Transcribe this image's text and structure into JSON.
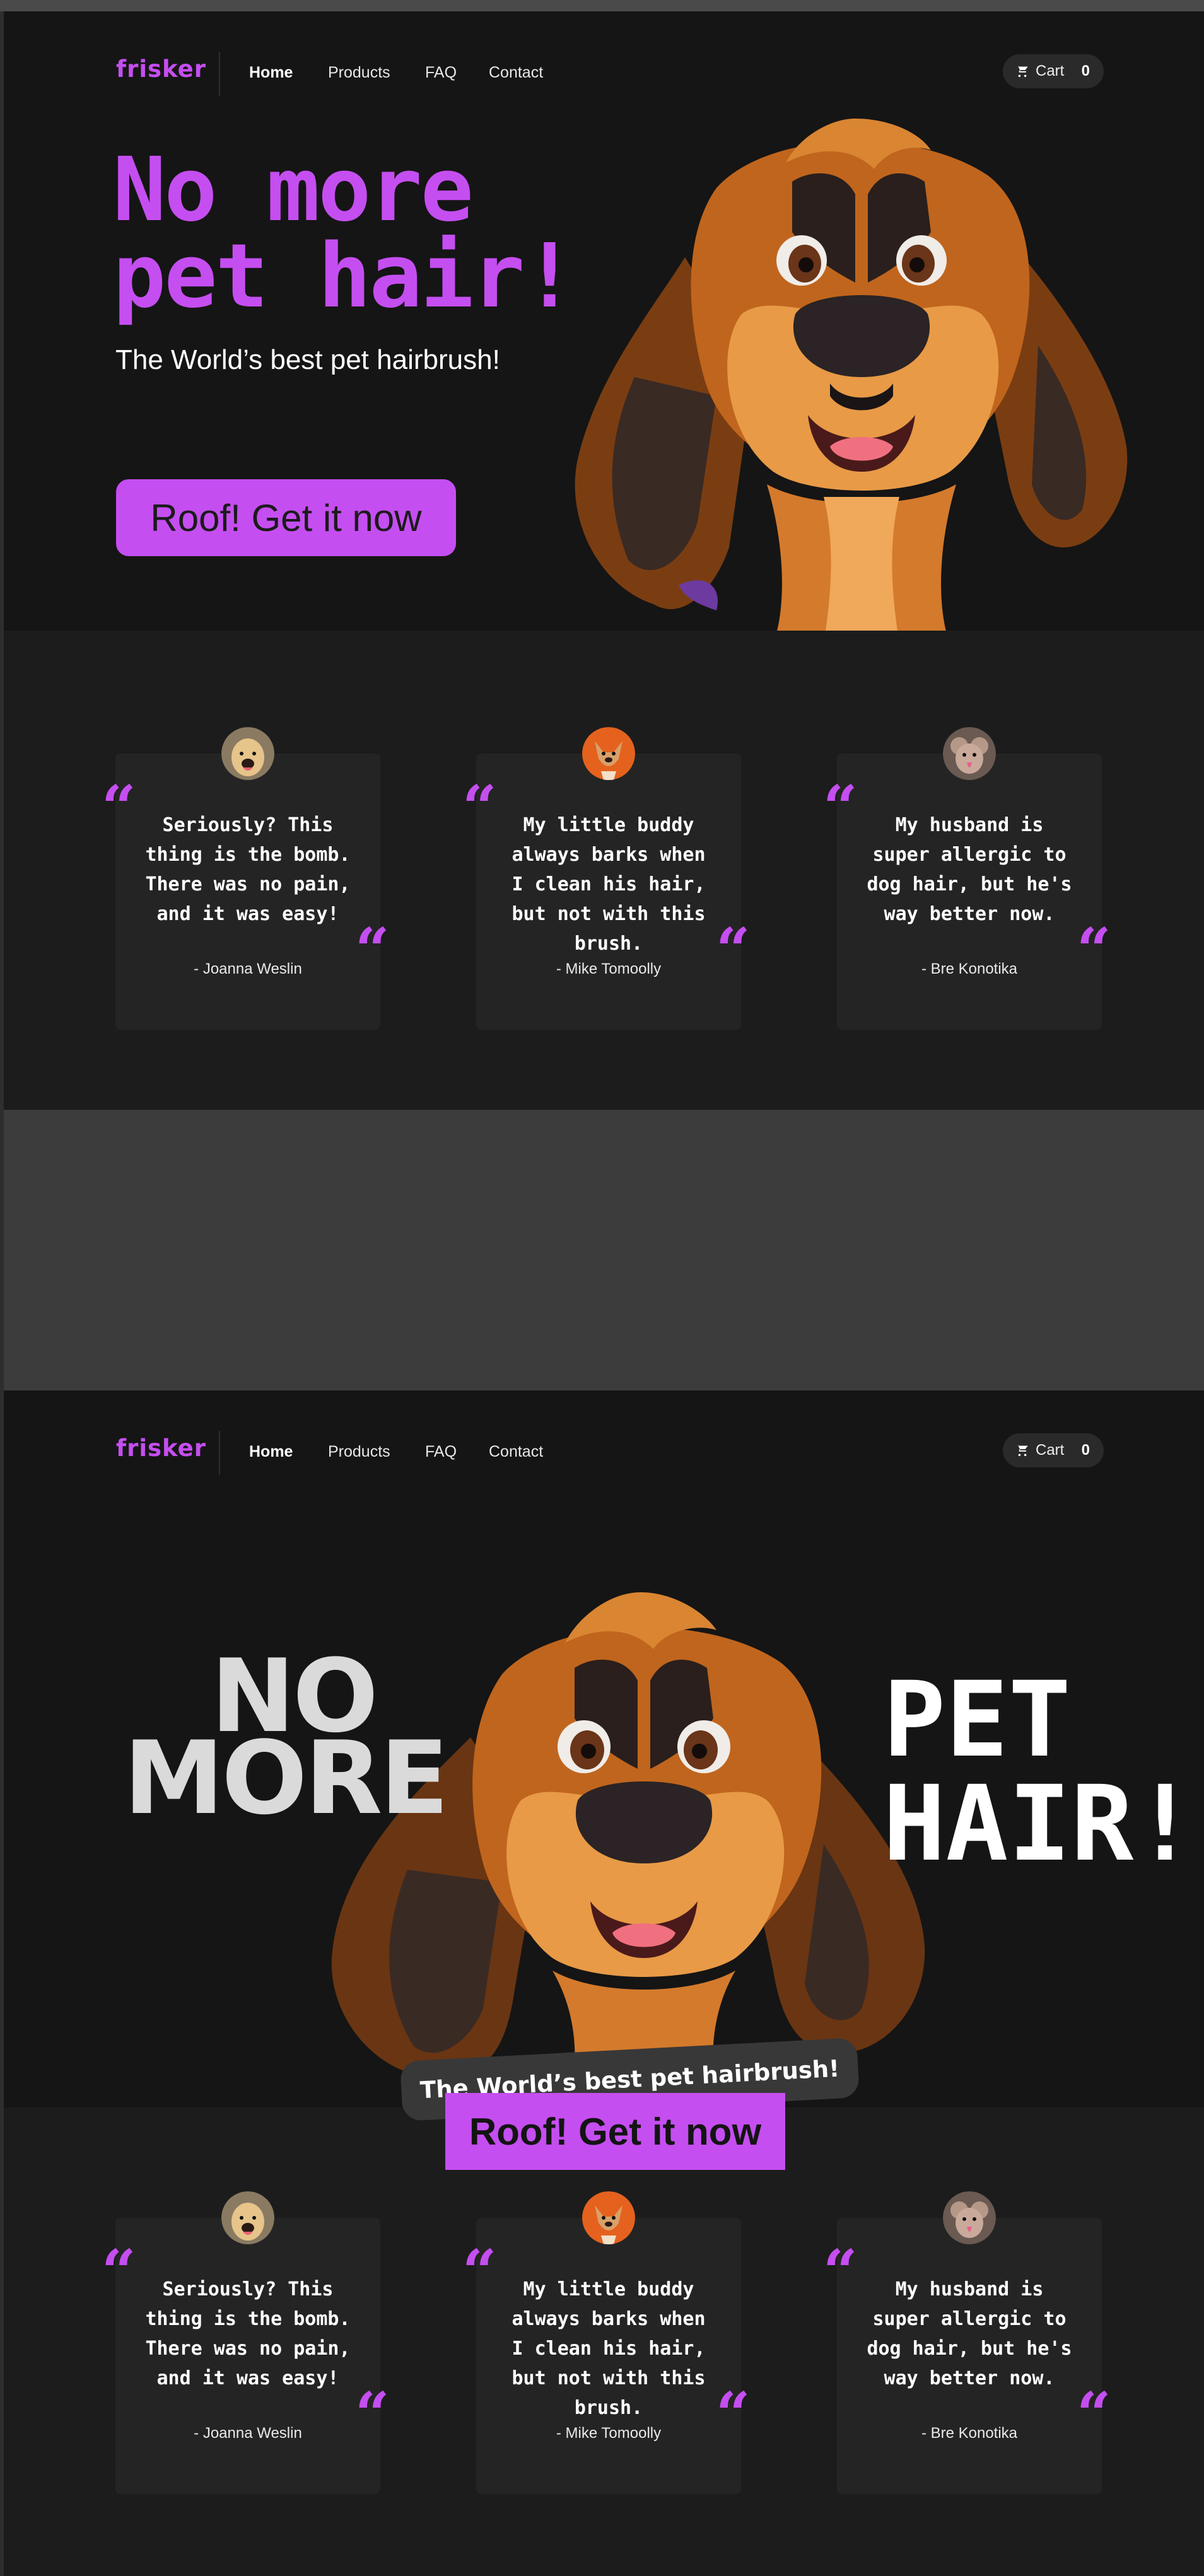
{
  "brand": {
    "logo": "frisker",
    "accent": "#c54ef0"
  },
  "nav": {
    "links": [
      "Home",
      "Products",
      "FAQ",
      "Contact"
    ],
    "cart_label": "Cart",
    "cart_count": "0"
  },
  "hero1": {
    "title_line1": "No more",
    "title_line2": "pet hair!",
    "subtitle": "The World’s best pet hairbrush!",
    "cta": "Roof! Get it now"
  },
  "hero2": {
    "left_line1": "NO",
    "left_line2": "MORE",
    "right_line1": "PET",
    "right_line2": "HAIR!",
    "tagline": "The World’s best pet hairbrush!",
    "cta": "Roof! Get it now"
  },
  "testimonials": [
    {
      "quote": "Seriously? This thing is the bomb. There was no pain, and it was easy!",
      "author": "- Joanna Weslin",
      "avatar": "golden-retriever-avatar"
    },
    {
      "quote": "My little buddy always barks when I clean his hair, but not with this brush.",
      "author": "- Mike Tomoolly",
      "avatar": "chihuahua-avatar"
    },
    {
      "quote": "My husband is super allergic to dog hair, but he's way better now.",
      "author": "- Bre Konotika",
      "avatar": "poodle-avatar"
    }
  ],
  "quote_marks": {
    "open": "“",
    "close": "“"
  }
}
